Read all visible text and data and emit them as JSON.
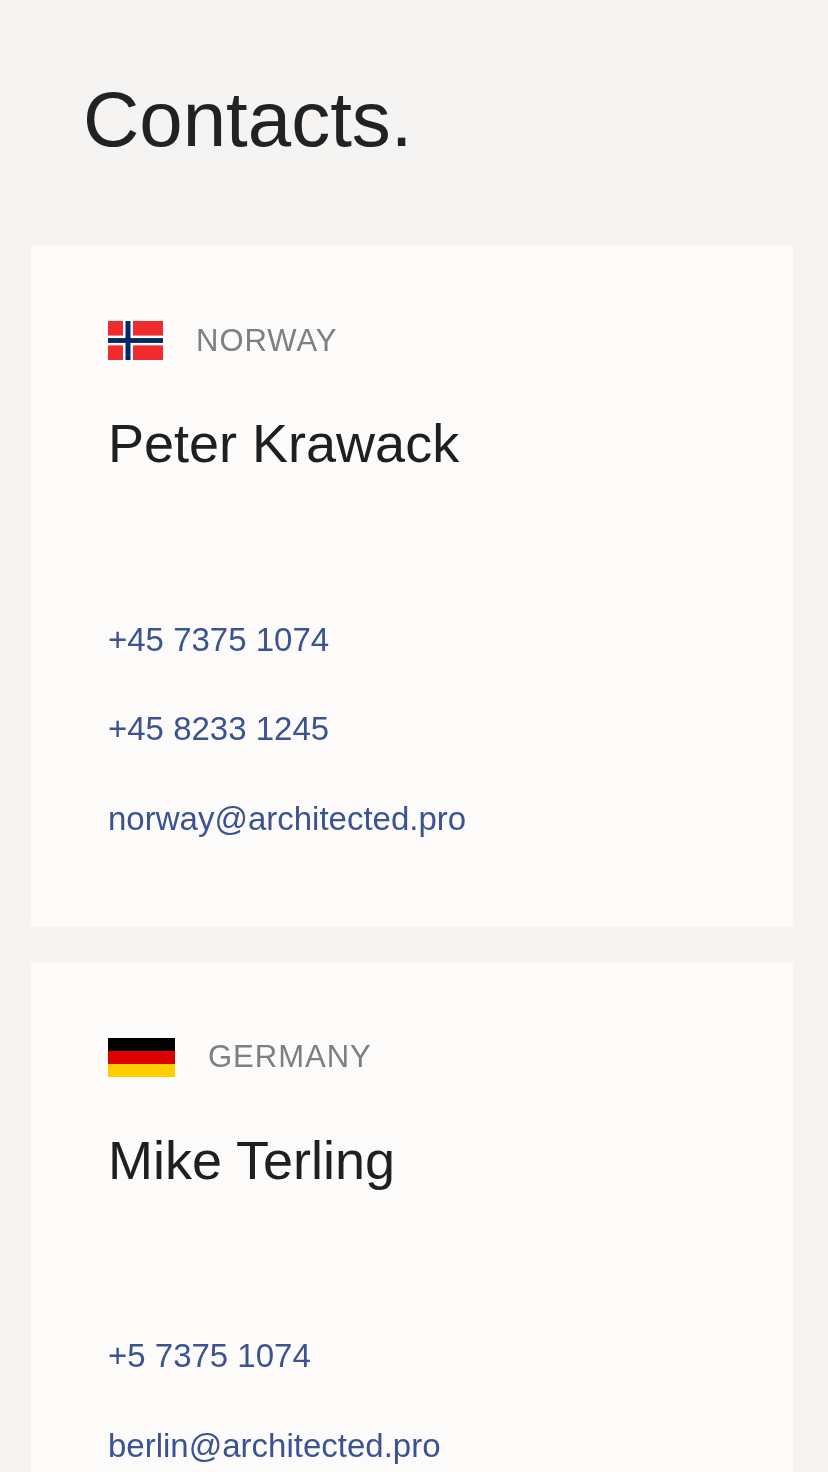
{
  "title": "Contacts.",
  "contacts": [
    {
      "flag": {
        "kind": "norway"
      },
      "country": "NORWAY",
      "name": "Peter Krawack",
      "phones": [
        "+45 7375 1074",
        "+45 8233 1245"
      ],
      "email": "norway@architected.pro"
    },
    {
      "flag": {
        "kind": "germany"
      },
      "country": "GERMANY",
      "name": "Mike Terling",
      "phones": [
        "+5 7375 1074"
      ],
      "email": "berlin@architected.pro"
    }
  ]
}
